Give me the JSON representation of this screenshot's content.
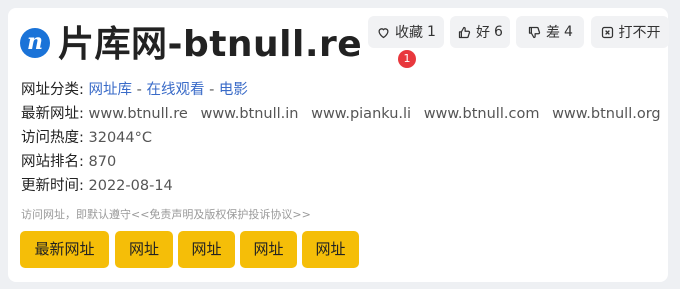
{
  "header": {
    "logo_letter": "n",
    "title": "片库网-btnull.re"
  },
  "actions": {
    "favorite": {
      "label": "收藏",
      "count": "1",
      "icon": "heart-icon"
    },
    "like": {
      "label": "好",
      "count": "6",
      "icon": "thumbs-up-icon"
    },
    "dislike": {
      "label": "差",
      "count": "4",
      "icon": "thumbs-down-icon"
    },
    "broken": {
      "label": "打不开",
      "icon": "broken-link-icon"
    },
    "badge_count": "1"
  },
  "info": {
    "category_label": "网址分类:",
    "categories": [
      "网址库",
      "在线观看",
      "电影"
    ],
    "category_sep": "-",
    "latest_label": "最新网址:",
    "latest_urls": [
      "www.btnull.re",
      "www.btnull.in",
      "www.pianku.li",
      "www.btnull.com",
      "www.btnull.org"
    ],
    "heat_label": "访问热度:",
    "heat_value": "32044°C",
    "rank_label": "网站排名:",
    "rank_value": "870",
    "updated_label": "更新时间:",
    "updated_value": "2022-08-14"
  },
  "notice": "访问网址，即默认遵守<<免责声明及版权保护投诉协议>>",
  "buttons": [
    "最新网址",
    "网址",
    "网址",
    "网址",
    "网址"
  ],
  "colors": {
    "accent_button": "#f5be08",
    "link": "#3a6bc8",
    "badge": "#e8383d",
    "logo": "#1a73d8"
  }
}
